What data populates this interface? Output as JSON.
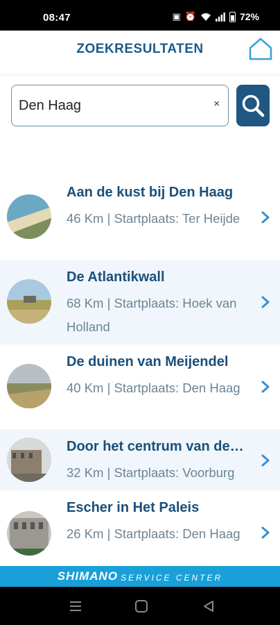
{
  "status": {
    "time": "08:47",
    "battery": "72%"
  },
  "header": {
    "title": "ZOEKRESULTATEN"
  },
  "search": {
    "value": "Den Haag",
    "clear": "×"
  },
  "results": [
    {
      "title": "Aan de kust bij Den Haag",
      "meta": "46 Km | Startplaats: Ter Heijde"
    },
    {
      "title": "De Atlantikwall",
      "meta": "68 Km | Startplaats: Hoek van Holland"
    },
    {
      "title": "De duinen van Meijendel",
      "meta": "40 Km | Startplaats: Den Haag"
    },
    {
      "title": "Door het centrum van de…",
      "meta": "32 Km | Startplaats: Voorburg"
    },
    {
      "title": "Escher in Het Paleis",
      "meta": "26 Km | Startplaats: Den Haag"
    }
  ],
  "footer": {
    "brand": "SHIMANO",
    "brand_sub": "SERVICE CENTER"
  },
  "colors": {
    "accent": "#1a4f7a",
    "search_button": "#1f5782",
    "brand": "#1aa0d8",
    "chevron": "#3a8fd0"
  }
}
